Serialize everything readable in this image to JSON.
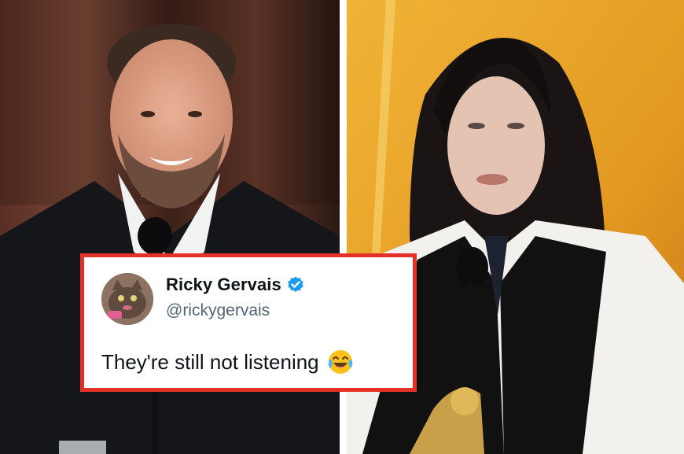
{
  "tweet": {
    "display_name": "Ricky Gervais",
    "handle": "@rickygervais",
    "text": "They're still not listening",
    "verified": true,
    "emoji": "face-with-tears-of-joy-icon"
  },
  "colors": {
    "card_border": "#e4322b",
    "name": "#0f1419",
    "handle": "#536471",
    "verified_badge": "#1d9bf0",
    "right_backdrop": "#e7a22a"
  }
}
